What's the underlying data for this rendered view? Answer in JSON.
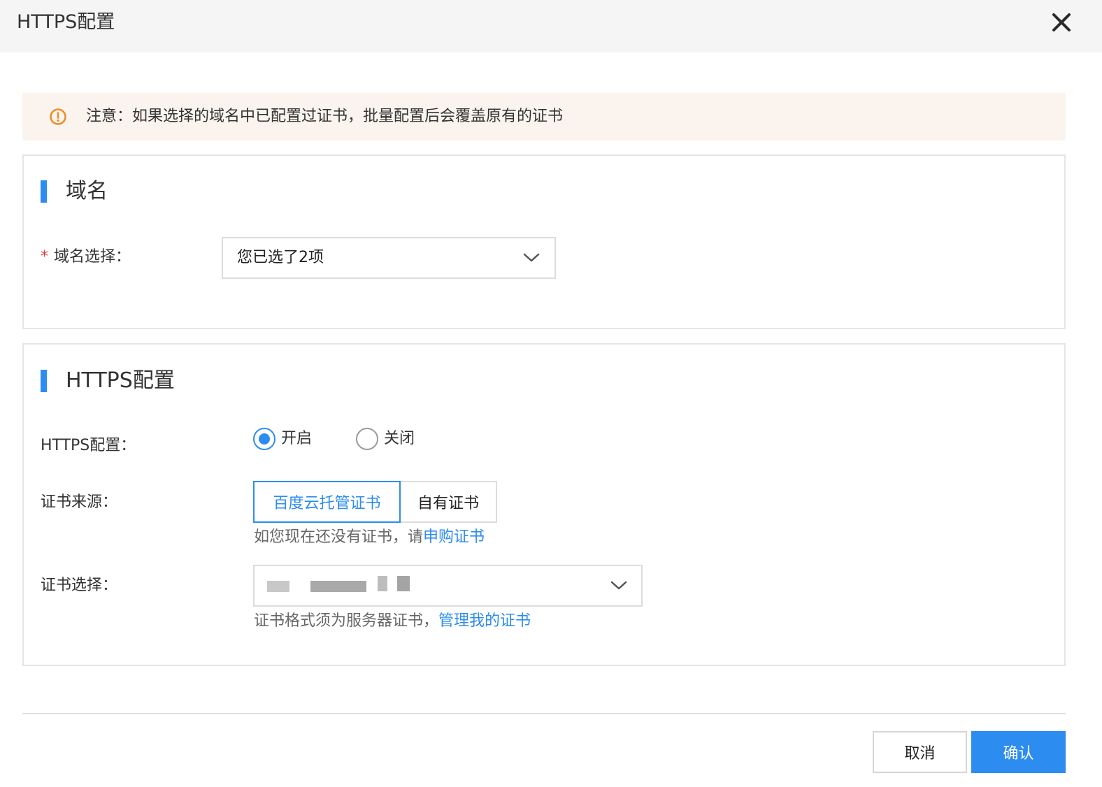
{
  "dialog": {
    "title": "HTTPS配置"
  },
  "notice": {
    "text": "注意：如果选择的域名中已配置过证书，批量配置后会覆盖原有的证书",
    "color": "#f08a24"
  },
  "domain_section": {
    "title": "域名",
    "required_mark": "*",
    "select_label": "域名选择：",
    "select_value": "您已选了2项"
  },
  "https_section": {
    "title": "HTTPS配置",
    "https_label": "HTTPS配置：",
    "https_options": [
      {
        "label": "开启",
        "checked": true
      },
      {
        "label": "关闭",
        "checked": false
      }
    ],
    "cert_source_label": "证书来源：",
    "cert_source_options": [
      {
        "label": "百度云托管证书",
        "active": true
      },
      {
        "label": "自有证书",
        "active": false
      }
    ],
    "cert_source_hint": "如您现在还没有证书，请",
    "cert_source_link": "申购证书",
    "cert_select_label": "证书选择：",
    "cert_select_hint": "证书格式须为服务器证书，",
    "cert_select_link": "管理我的证书"
  },
  "footer": {
    "cancel_label": "取消",
    "confirm_label": "确认"
  },
  "colors": {
    "accent": "#2d8cf0",
    "required": "#e23c39",
    "notice_bg": "#fbf4ee"
  }
}
